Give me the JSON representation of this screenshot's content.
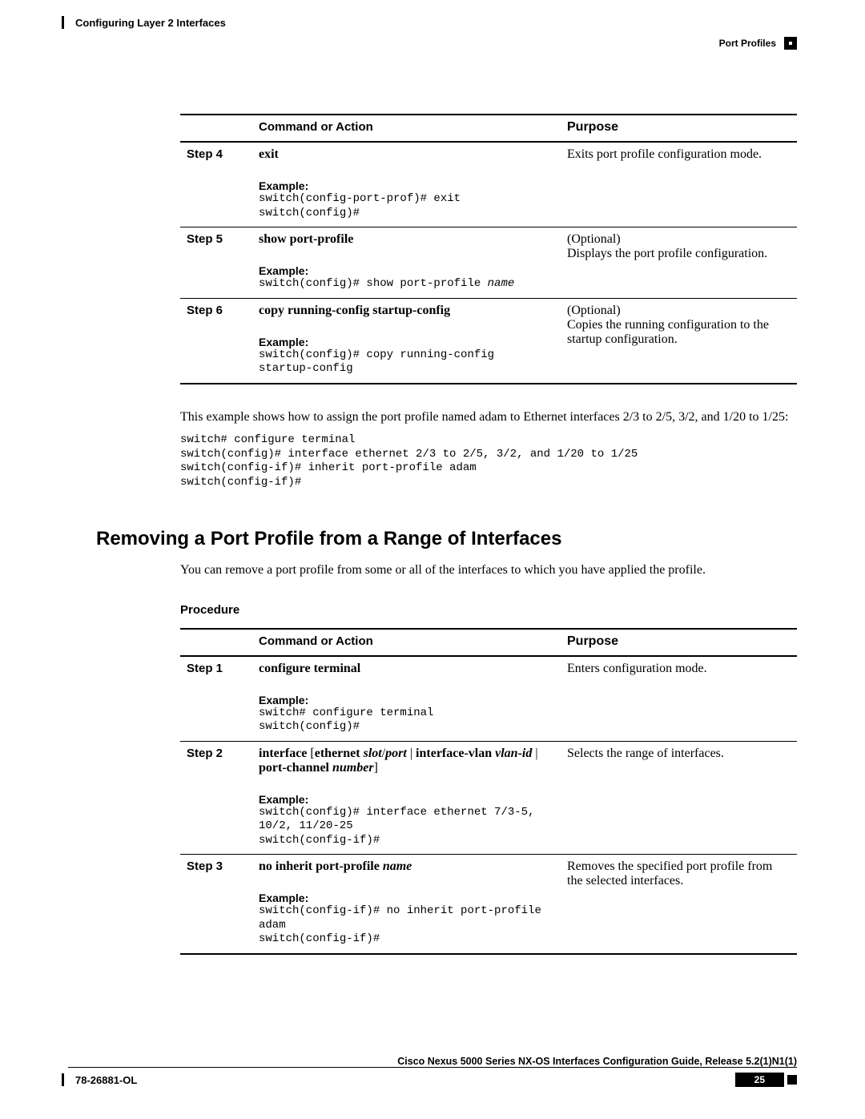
{
  "header": {
    "chapter": "Configuring Layer 2 Interfaces",
    "section": "Port Profiles"
  },
  "table1": {
    "headers": {
      "blank": "",
      "cmd": "Command or Action",
      "purpose": "Purpose"
    },
    "rows": [
      {
        "step": "Step 4",
        "cmd_title": "exit",
        "example_label": "Example:",
        "example_code": "switch(config-port-prof)# exit\nswitch(config)#",
        "purpose": "Exits port profile configuration mode."
      },
      {
        "step": "Step 5",
        "cmd_title": "show port-profile",
        "example_label": "Example:",
        "example_code_prefix": "switch(config)# show port-profile ",
        "example_code_ital": "name",
        "purpose": "(Optional)\nDisplays the port profile configuration."
      },
      {
        "step": "Step 6",
        "cmd_title": "copy running-config startup-config",
        "example_label": "Example:",
        "example_code": "switch(config)# copy running-config\nstartup-config",
        "purpose": "(Optional)\nCopies the running configuration to the startup configuration."
      }
    ]
  },
  "para1": "This example shows how to assign the port profile named adam to Ethernet interfaces 2/3 to 2/5, 3/2, and 1/20 to 1/25:",
  "code_block": "switch# configure terminal\nswitch(config)# interface ethernet 2/3 to 2/5, 3/2, and 1/20 to 1/25\nswitch(config-if)# inherit port-profile adam\nswitch(config-if)#",
  "heading2": "Removing a Port Profile from a Range of Interfaces",
  "para2": "You can remove a port profile from some or all of the interfaces to which you have applied the profile.",
  "procedure_label": "Procedure",
  "table2": {
    "headers": {
      "blank": "",
      "cmd": "Command or Action",
      "purpose": "Purpose"
    },
    "rows": [
      {
        "step": "Step 1",
        "cmd_title": "configure terminal",
        "example_label": "Example:",
        "example_code": "switch# configure terminal\nswitch(config)#",
        "purpose": "Enters configuration mode."
      },
      {
        "step": "Step 2",
        "cmd_parts": {
          "p1": "interface",
          "p2": " [",
          "p3": "ethernet",
          "p4": " slot",
          "p5": "/",
          "p6": "port",
          "p7": " | ",
          "p8": "interface-vlan",
          "p9": " vlan-id",
          "p10": " | ",
          "p11": "port-channel",
          "p12": " number",
          "p13": "]"
        },
        "example_label": "Example:",
        "example_code": "switch(config)# interface ethernet 7/3-5,\n10/2, 11/20-25\nswitch(config-if)#",
        "purpose": "Selects the range of interfaces."
      },
      {
        "step": "Step 3",
        "cmd_title": "no inherit port-profile",
        "cmd_ital": " name",
        "example_label": "Example:",
        "example_code": "switch(config-if)# no inherit port-profile\nadam\nswitch(config-if)#",
        "purpose": "Removes the specified port profile from the selected interfaces."
      }
    ]
  },
  "footer": {
    "guide": "Cisco Nexus 5000 Series NX-OS Interfaces Configuration Guide, Release 5.2(1)N1(1)",
    "part_number": "78-26881-OL",
    "page": "25"
  }
}
